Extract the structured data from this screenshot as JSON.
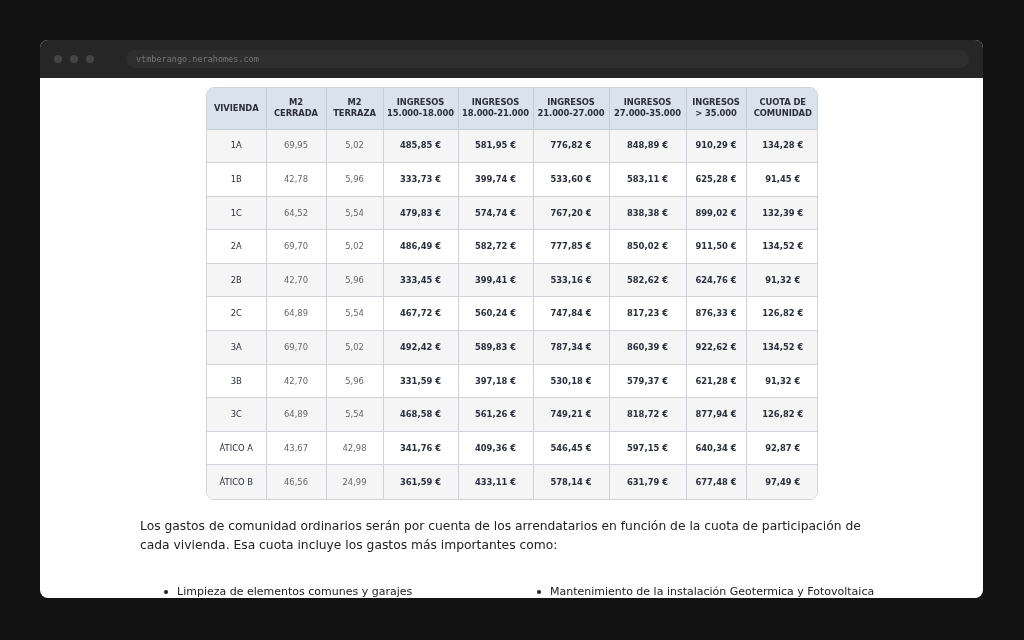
{
  "browser": {
    "url": "vtmberango.nerahomes.com"
  },
  "table": {
    "columns": [
      {
        "lines": [
          "VIVIENDA"
        ]
      },
      {
        "lines": [
          "M2",
          "CERRADA"
        ]
      },
      {
        "lines": [
          "M2",
          "TERRAZA"
        ]
      },
      {
        "lines": [
          "INGRESOS",
          "15.000-18.000"
        ]
      },
      {
        "lines": [
          "INGRESOS",
          "18.000-21.000"
        ]
      },
      {
        "lines": [
          "INGRESOS",
          "21.000-27.000"
        ]
      },
      {
        "lines": [
          "INGRESOS",
          "27.000-35.000"
        ]
      },
      {
        "lines": [
          "INGRESOS",
          "> 35.000"
        ]
      },
      {
        "lines": [
          "CUOTA DE",
          "COMUNIDAD"
        ]
      }
    ],
    "rows": [
      [
        "1A",
        "69,95",
        "5,02",
        "485,85 €",
        "581,95 €",
        "776,82 €",
        "848,89 €",
        "910,29 €",
        "134,28 €"
      ],
      [
        "1B",
        "42,78",
        "5,96",
        "333,73 €",
        "399,74 €",
        "533,60 €",
        "583,11 €",
        "625,28 €",
        "91,45 €"
      ],
      [
        "1C",
        "64,52",
        "5,54",
        "479,83 €",
        "574,74 €",
        "767,20 €",
        "838,38 €",
        "899,02 €",
        "132,39 €"
      ],
      [
        "2A",
        "69,70",
        "5,02",
        "486,49 €",
        "582,72 €",
        "777,85 €",
        "850,02 €",
        "911,50 €",
        "134,52 €"
      ],
      [
        "2B",
        "42,70",
        "5,96",
        "333,45 €",
        "399,41 €",
        "533,16 €",
        "582,62 €",
        "624,76 €",
        "91,32 €"
      ],
      [
        "2C",
        "64,89",
        "5,54",
        "467,72 €",
        "560,24 €",
        "747,84 €",
        "817,23 €",
        "876,33 €",
        "126,82 €"
      ],
      [
        "3A",
        "69,70",
        "5,02",
        "492,42 €",
        "589,83 €",
        "787,34 €",
        "860,39 €",
        "922,62 €",
        "134,52 €"
      ],
      [
        "3B",
        "42,70",
        "5,96",
        "331,59 €",
        "397,18 €",
        "530,18 €",
        "579,37 €",
        "621,28 €",
        "91,32 €"
      ],
      [
        "3C",
        "64,89",
        "5,54",
        "468,58 €",
        "561,26 €",
        "749,21 €",
        "818,72 €",
        "877,94 €",
        "126,82 €"
      ],
      [
        "ÁTICO A",
        "43,67",
        "42,98",
        "341,76 €",
        "409,36 €",
        "546,45 €",
        "597,15 €",
        "640,34 €",
        "92,87 €"
      ],
      [
        "ÁTICO B",
        "46,56",
        "24,99",
        "361,59 €",
        "433,11 €",
        "578,14 €",
        "631,79 €",
        "677,48 €",
        "97,49 €"
      ]
    ]
  },
  "paragraph": "Los gastos de comunidad ordinarios serán por cuenta de los arrendatarios en función de la cuota de participación de cada vivienda. Esa cuota incluye los gastos más importantes como:",
  "list": [
    "Limpieza de elementos comunes y garajes",
    "Mantenimiento de la instalación Geotermica y Fotovoltaica"
  ]
}
